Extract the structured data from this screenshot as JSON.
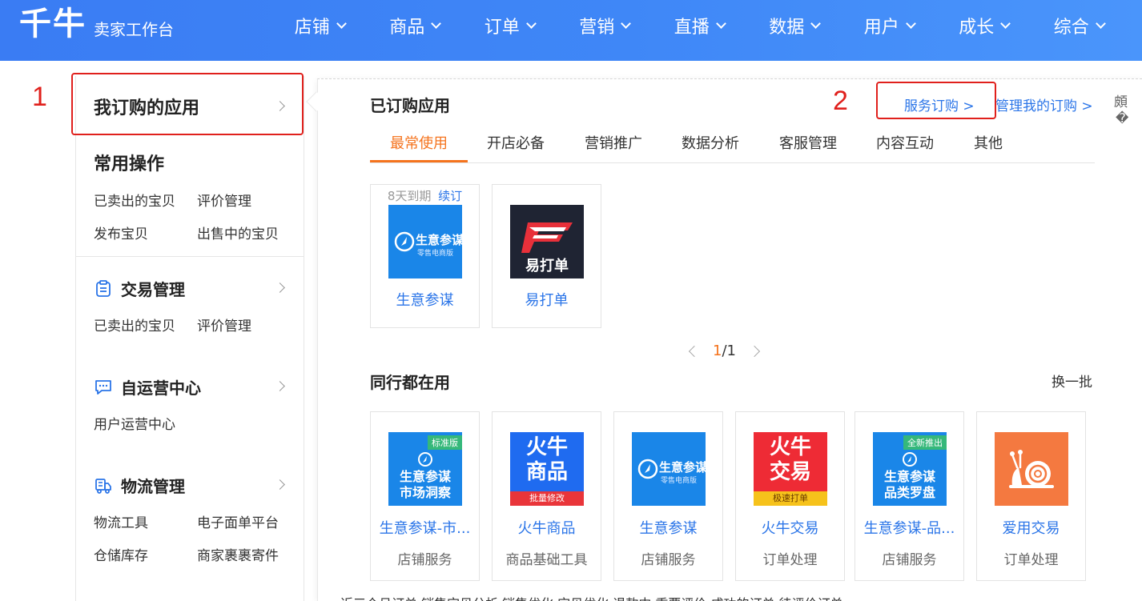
{
  "header": {
    "logo": "千牛",
    "subtitle": "卖家工作台",
    "nav": [
      "店铺",
      "商品",
      "订单",
      "营销",
      "直播",
      "数据",
      "用户",
      "成长",
      "综合"
    ]
  },
  "annotations": {
    "one": "1",
    "two": "2"
  },
  "left": {
    "my_apps": "我订购的应用",
    "common": {
      "title": "常用操作",
      "links": [
        "已卖出的宝贝",
        "评价管理",
        "发布宝贝",
        "出售中的宝贝"
      ]
    },
    "trade": {
      "title": "交易管理",
      "links": [
        "已卖出的宝贝",
        "评价管理"
      ]
    },
    "selfop": {
      "title": "自运营中心",
      "links": [
        "用户运营中心"
      ]
    },
    "logistics": {
      "title": "物流管理",
      "links": [
        "物流工具",
        "电子面单平台",
        "仓储库存",
        "商家裹裹寄件"
      ]
    }
  },
  "popup": {
    "purchased_title": "已订购应用",
    "service_order": "服务订购 >",
    "manage_order": "管理我的订购 >",
    "side_glyph": "頗",
    "tabs": [
      "最常使用",
      "开店必备",
      "营销推广",
      "数据分析",
      "客服管理",
      "内容互动",
      "其他"
    ],
    "purchased": [
      {
        "name": "生意参谋",
        "expiry": "8天到期",
        "renew": "续订",
        "icon_line1": "生意参谋",
        "icon_line2": "零售电商版",
        "icon_color": "#1a86e8"
      },
      {
        "name": "易打单",
        "icon_text": "易打单",
        "icon_color": "#1f2433"
      }
    ],
    "pager": {
      "current": "1",
      "rest": "/1"
    },
    "peers_title": "同行都在用",
    "refresh": "换一批",
    "peers": [
      {
        "name": "生意参谋-市...",
        "category": "店铺服务",
        "badge": "标准版",
        "icon_l1": "生意参谋",
        "icon_l2": "市场洞察",
        "icon_color": "#1a86e8"
      },
      {
        "name": "火牛商品",
        "category": "商品基础工具",
        "icon_l1": "火牛",
        "icon_l2": "商品",
        "strip": "批量修改",
        "icon_color": "#1f6bf0"
      },
      {
        "name": "生意参谋",
        "category": "店铺服务",
        "icon_l1": "生意参谋",
        "icon_l2": "零售电商版",
        "icon_color": "#1a86e8"
      },
      {
        "name": "火牛交易",
        "category": "订单处理",
        "icon_l1": "火牛",
        "icon_l2": "交易",
        "strip": "极速打单",
        "icon_color": "#ee2b35"
      },
      {
        "name": "生意参谋-品...",
        "category": "店铺服务",
        "badge": "全新推出",
        "icon_l1": "生意参谋",
        "icon_l2": "品类罗盘",
        "icon_color": "#1a86e8"
      },
      {
        "name": "爱用交易",
        "category": "订单处理",
        "icon_color": "#f47940"
      }
    ],
    "cut_row": "近三个月订单   销售宝贝分析   销售优化   宝贝优化   退款中   重要评价   成功的订单   待评价订单"
  }
}
